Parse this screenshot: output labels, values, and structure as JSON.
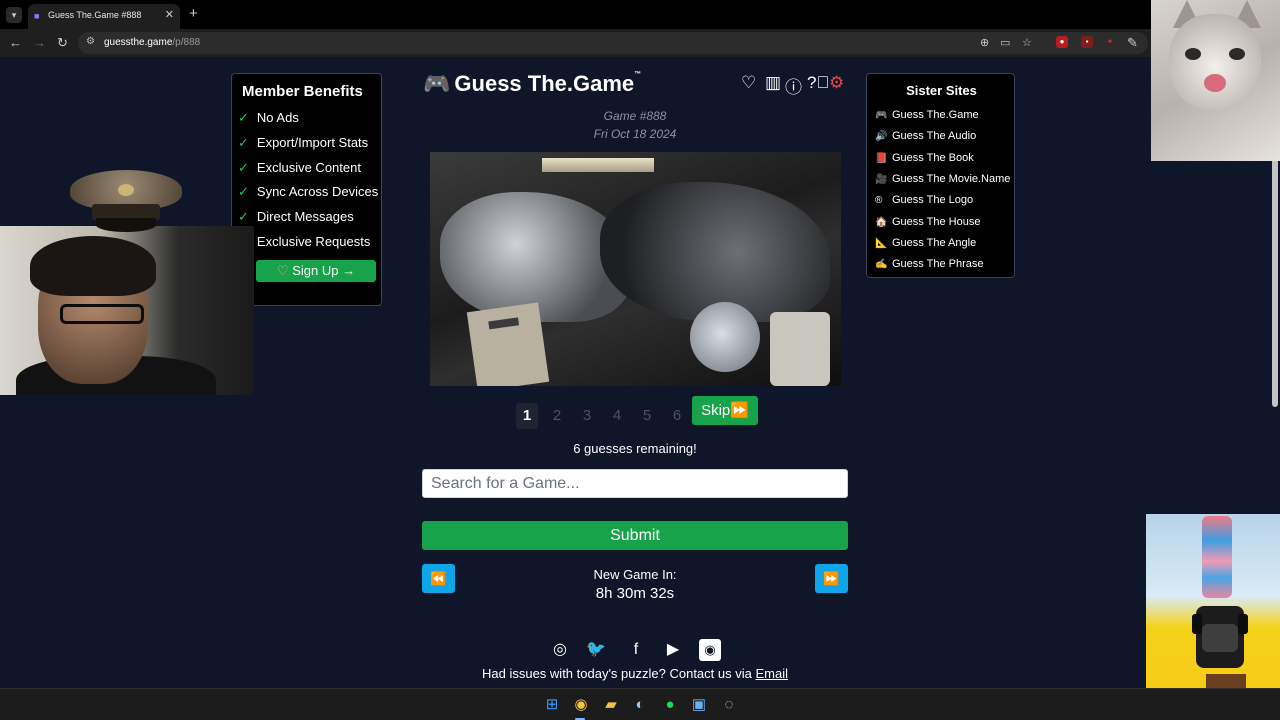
{
  "browser": {
    "tab_title": "Guess The.Game #888",
    "url_host": "guessthe.game",
    "url_path": "/p/888"
  },
  "member": {
    "title": "Member Benefits",
    "benefits": [
      "No Ads",
      "Export/Import Stats",
      "Exclusive Content",
      "Sync Across Devices",
      "Direct Messages",
      "Exclusive Requests"
    ],
    "signup_label": "Sign Up →"
  },
  "header": {
    "logo_text": "Guess The.Game",
    "trademark": "™"
  },
  "game": {
    "number": "Game #888",
    "date": "Fri Oct 18 2024"
  },
  "guesses": {
    "slots": [
      "1",
      "2",
      "3",
      "4",
      "5",
      "6"
    ],
    "active_slot": "1",
    "skip_label": "Skip",
    "remaining": "6 guesses remaining!"
  },
  "search": {
    "placeholder": "Search for a Game..."
  },
  "submit_label": "Submit",
  "countdown": {
    "label": "New Game In:",
    "time": "8h 30m 32s"
  },
  "footer": {
    "issues_text": "Had issues with today's puzzle? Contact us via",
    "email_link": "Email",
    "socials": [
      "instagram-icon",
      "twitter-icon",
      "facebook-icon",
      "youtube-icon",
      "rss-icon"
    ]
  },
  "sister": {
    "title": "Sister Sites",
    "items": [
      {
        "label": "Guess The.Game",
        "icon": "🎮"
      },
      {
        "label": "Guess The Audio",
        "icon": "🔊"
      },
      {
        "label": "Guess The Book",
        "icon": "📕"
      },
      {
        "label": "Guess The Movie.Name",
        "icon": "🎥"
      },
      {
        "label": "Guess The Logo",
        "icon": "®"
      },
      {
        "label": "Guess The House",
        "icon": "🏠"
      },
      {
        "label": "Guess The Angle",
        "icon": "📐"
      },
      {
        "label": "Guess The Phrase",
        "icon": "✍"
      }
    ]
  },
  "colors": {
    "background": "#0f1629",
    "accent_green": "#16a34a",
    "accent_blue": "#0ea5e9",
    "settings_red": "#ef4444"
  }
}
